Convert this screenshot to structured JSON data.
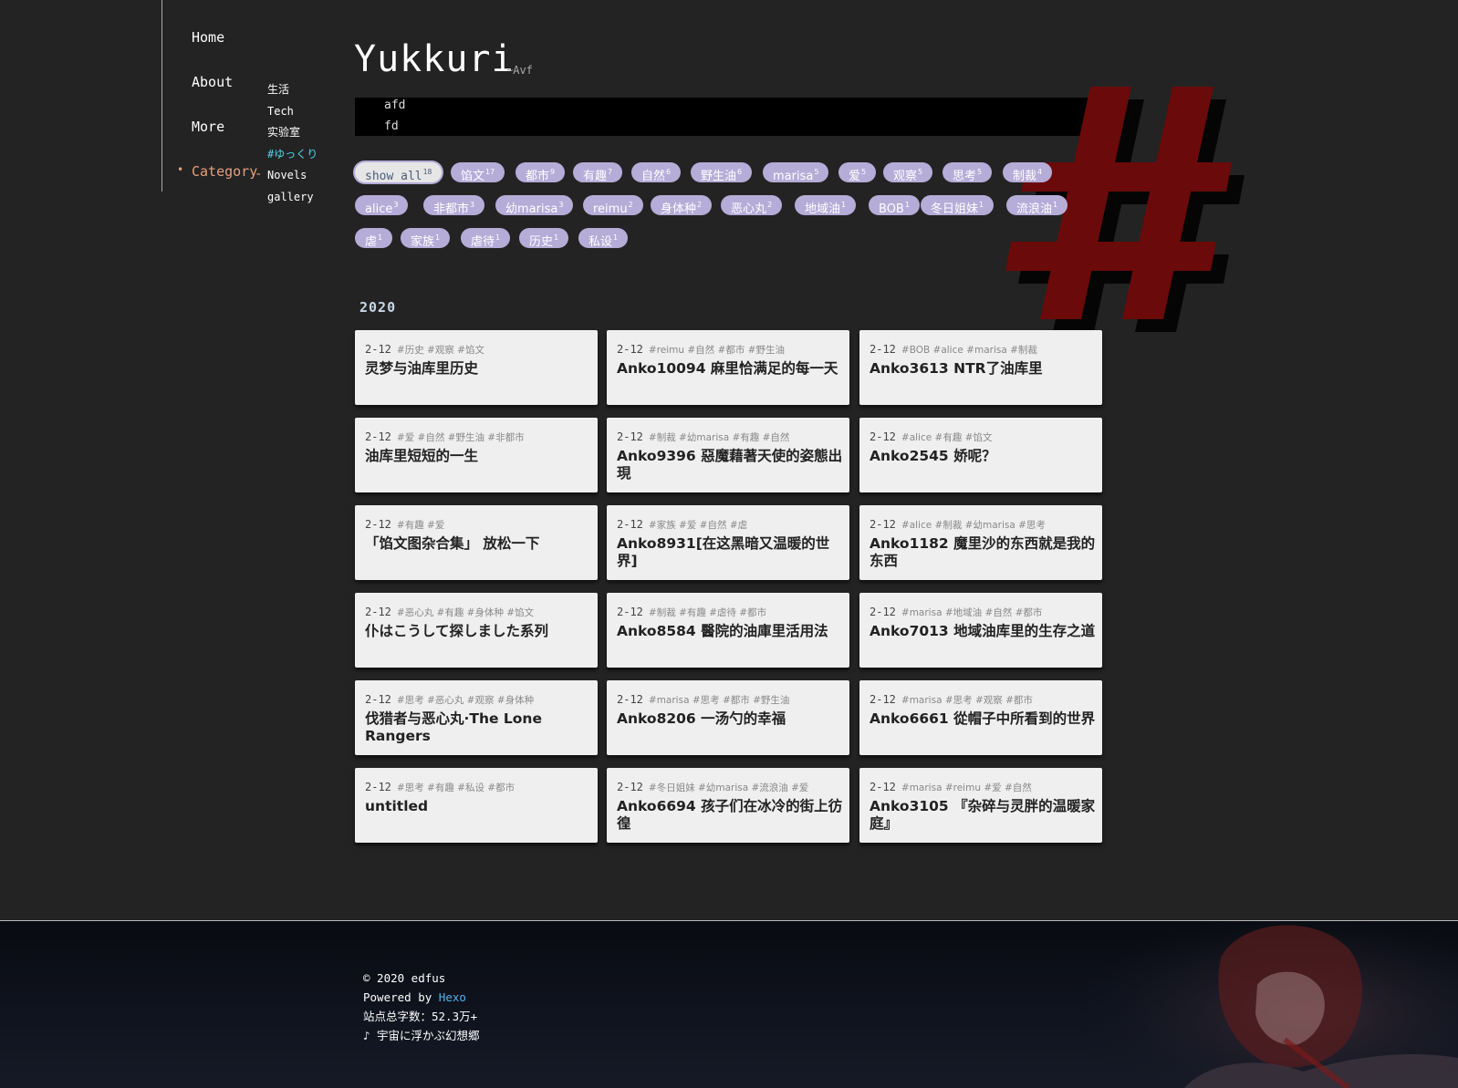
{
  "nav": {
    "items": [
      {
        "label": "Home"
      },
      {
        "label": "About"
      },
      {
        "label": "More"
      },
      {
        "label": "Category"
      }
    ],
    "categories": [
      "生活",
      "Tech",
      "实验室",
      "#ゆっくり",
      "Novels",
      "gallery"
    ]
  },
  "header": {
    "title": "Yukkuri",
    "subtitle": "~Avf",
    "notice_lines": [
      "afd",
      "fd"
    ]
  },
  "tags": [
    {
      "name": "show all",
      "count": "18"
    },
    {
      "name": "馅文",
      "count": "17"
    },
    {
      "name": "都市",
      "count": "9"
    },
    {
      "name": "有趣",
      "count": "7"
    },
    {
      "name": "自然",
      "count": "6"
    },
    {
      "name": "野生油",
      "count": "6"
    },
    {
      "name": "marisa",
      "count": "5"
    },
    {
      "name": "爱",
      "count": "5"
    },
    {
      "name": "观察",
      "count": "5"
    },
    {
      "name": "思考",
      "count": "5"
    },
    {
      "name": "制裁",
      "count": "4"
    },
    {
      "name": "alice",
      "count": "3"
    },
    {
      "name": "非都市",
      "count": "3"
    },
    {
      "name": "幼marisa",
      "count": "3"
    },
    {
      "name": "reimu",
      "count": "2"
    },
    {
      "name": "身体种",
      "count": "2"
    },
    {
      "name": "恶心丸",
      "count": "2"
    },
    {
      "name": "地域油",
      "count": "1"
    },
    {
      "name": "BOB",
      "count": "1"
    },
    {
      "name": "冬日姐妹",
      "count": "1"
    },
    {
      "name": "流浪油",
      "count": "1"
    },
    {
      "name": "虐",
      "count": "1"
    },
    {
      "name": "家族",
      "count": "1"
    },
    {
      "name": "虐待",
      "count": "1"
    },
    {
      "name": "历史",
      "count": "1"
    },
    {
      "name": "私设",
      "count": "1"
    }
  ],
  "year": "2020",
  "posts": [
    {
      "date": "2-12",
      "tags": "#历史 #观察 #馅文",
      "title": "灵梦与油库里历史"
    },
    {
      "date": "2-12",
      "tags": "#reimu #自然 #都市 #野生油",
      "title": "Anko10094 麻里恰满足的每一天"
    },
    {
      "date": "2-12",
      "tags": "#BOB #alice #marisa #制裁",
      "title": "Anko3613 NTR了油库里"
    },
    {
      "date": "2-12",
      "tags": "#爱 #自然 #野生油 #非都市",
      "title": "油库里短短的一生"
    },
    {
      "date": "2-12",
      "tags": "#制裁 #幼marisa #有趣 #自然",
      "title": "Anko9396 惡魔藉著天使的姿態出現"
    },
    {
      "date": "2-12",
      "tags": "#alice #有趣 #馅文",
      "title": "Anko2545 娇呢？"
    },
    {
      "date": "2-12",
      "tags": "#有趣 #爱",
      "title": "「馅文图杂合集」 放松一下"
    },
    {
      "date": "2-12",
      "tags": "#家族 #爱 #自然 #虐",
      "title": "Anko8931[在这黑暗又温暖的世界]"
    },
    {
      "date": "2-12",
      "tags": "#alice #制裁 #幼marisa #思考",
      "title": "Anko1182 魔里沙的东西就是我的东西"
    },
    {
      "date": "2-12",
      "tags": "#恶心丸 #有趣 #身体种 #馅文",
      "title": "仆はこうして探しました系列"
    },
    {
      "date": "2-12",
      "tags": "#制裁 #有趣 #虐待 #都市",
      "title": "Anko8584 醫院的油庫里活用法"
    },
    {
      "date": "2-12",
      "tags": "#marisa #地域油 #自然 #都市",
      "title": "Anko7013 地域油库里的生存之道"
    },
    {
      "date": "2-12",
      "tags": "#思考 #恶心丸 #观察 #身体种",
      "title": "伐猎者与恶心丸·The Lone Rangers"
    },
    {
      "date": "2-12",
      "tags": "#marisa #思考 #都市 #野生油",
      "title": "Anko8206 一汤勺的幸福"
    },
    {
      "date": "2-12",
      "tags": "#marisa #思考 #观察 #都市",
      "title": "Anko6661 從帽子中所看到的世界"
    },
    {
      "date": "2-12",
      "tags": "#思考 #有趣 #私设 #都市",
      "title": "untitled"
    },
    {
      "date": "2-12",
      "tags": "#冬日姐妹 #幼marisa #流浪油 #爱",
      "title": "Anko6694 孩子们在冰冷的街上彷徨"
    },
    {
      "date": "2-12",
      "tags": "#marisa #reimu #爱 #自然",
      "title": "Anko3105 『杂碎与灵胖的温暖家庭』"
    }
  ],
  "footer": {
    "copyright": "© 2020 edfus",
    "powered_prefix": "Powered by ",
    "powered_link": "Hexo",
    "word_count": "站点总字数：52.3万+",
    "music": "♪ 宇宙に浮かぶ幻想郷"
  },
  "colors": {
    "background": "#232323",
    "tag": "#b5acd8",
    "active_nav": "#e8a07a",
    "current_category": "#4fd1e8",
    "hash": "#6b0a0a"
  }
}
